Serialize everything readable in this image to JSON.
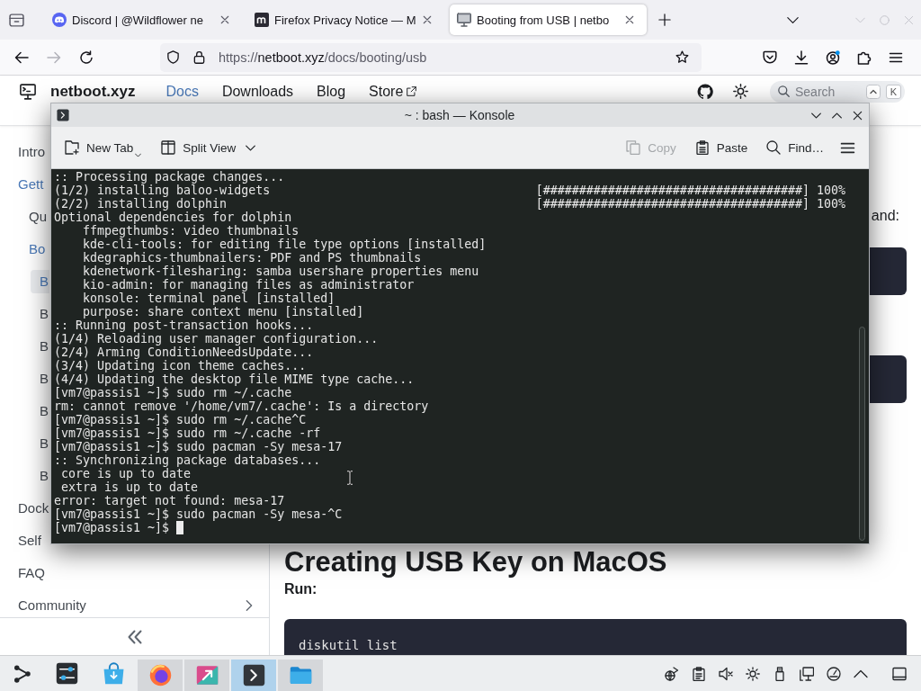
{
  "browser": {
    "tabs": [
      {
        "title": "Discord | @Wildflower ne",
        "selected": false
      },
      {
        "title": "Firefox Privacy Notice — M",
        "selected": false
      },
      {
        "title": "Booting from USB | netbo",
        "selected": true
      }
    ],
    "nav_buttons": [
      {
        "disabled": false
      },
      {
        "disabled": true
      },
      {
        "disabled": false
      }
    ],
    "url": "https://**netboot.xyz**/docs/booting/usb"
  },
  "site": {
    "header": {
      "title": "netboot.xyz",
      "links": [
        {
          "label": "Docs",
          "selected": true,
          "external": false
        },
        {
          "label": "Downloads",
          "selected": false,
          "external": false
        },
        {
          "label": "Blog",
          "selected": false,
          "external": false
        },
        {
          "label": "Store",
          "selected": false,
          "external": true
        }
      ],
      "search": {
        "placeholder": "Search",
        "key": "K"
      }
    },
    "sidebar": {
      "items": [
        {
          "label": "Intro",
          "selected": false
        },
        {
          "label": "Gett",
          "selected": false,
          "expanded": true,
          "children": [
            {
              "label": "Qu",
              "selected": false
            },
            {
              "label": "Bo",
              "selected": false,
              "expanded": true,
              "children": [
                {
                  "label": "B",
                  "selected": true
                },
                {
                  "label": "B",
                  "selected": false
                },
                {
                  "label": "B",
                  "selected": false
                },
                {
                  "label": "B",
                  "selected": false
                },
                {
                  "label": "B",
                  "selected": false
                },
                {
                  "label": "B",
                  "selected": false
                },
                {
                  "label": "B",
                  "selected": false
                }
              ]
            }
          ]
        },
        {
          "label": "Dock",
          "selected": false
        },
        {
          "label": "Self",
          "selected": false
        },
        {
          "label": "FAQ",
          "selected": false
        },
        {
          "label": "Community",
          "selected": false,
          "expanded": false
        }
      ]
    },
    "content": {
      "paragraph_end": "and:",
      "heading": "Creating USB Key on MacOS",
      "step_label": "Run:",
      "code": "diskutil list"
    }
  },
  "konsole": {
    "title": "~ : bash — Konsole",
    "toolbar": [
      {
        "label": "New Tab",
        "disabled": false
      },
      {
        "label": "Split View",
        "disabled": false
      },
      {
        "label": "Copy",
        "disabled": true
      },
      {
        "label": "Paste",
        "disabled": false
      },
      {
        "label": "Find…",
        "disabled": false
      }
    ],
    "terminal": {
      "lines": [
        {
          "kind": "out",
          "text": ":: Processing package changes..."
        },
        {
          "kind": "out",
          "text": "(1/2) installing baloo-widgets",
          "progress": "[####################################] 100%"
        },
        {
          "kind": "out",
          "text": "(2/2) installing dolphin",
          "progress": "[####################################] 100%"
        },
        {
          "kind": "out",
          "text": "Optional dependencies for dolphin"
        },
        {
          "kind": "dep",
          "text": "ffmpegthumbs: video thumbnails"
        },
        {
          "kind": "dep",
          "text": "kde-cli-tools: for editing file type options [installed]"
        },
        {
          "kind": "dep",
          "text": "kdegraphics-thumbnailers: PDF and PS thumbnails"
        },
        {
          "kind": "dep",
          "text": "kdenetwork-filesharing: samba usershare properties menu"
        },
        {
          "kind": "dep",
          "text": "kio-admin: for managing files as administrator"
        },
        {
          "kind": "dep",
          "text": "konsole: terminal panel [installed]"
        },
        {
          "kind": "dep",
          "text": "purpose: share context menu [installed]"
        },
        {
          "kind": "out",
          "text": ":: Running post-transaction hooks..."
        },
        {
          "kind": "out",
          "text": "(1/4) Reloading user manager configuration..."
        },
        {
          "kind": "out",
          "text": "(2/4) Arming ConditionNeedsUpdate..."
        },
        {
          "kind": "out",
          "text": "(3/4) Updating icon theme caches..."
        },
        {
          "kind": "out",
          "text": "(4/4) Updating the desktop file MIME type cache..."
        },
        {
          "kind": "out",
          "text": "[vm7@passis1 ~]$ sudo rm ~/.cache"
        },
        {
          "kind": "out",
          "text": "rm: cannot remove '/home/vm7/.cache': Is a directory"
        },
        {
          "kind": "out",
          "text": "[vm7@passis1 ~]$ sudo rm ~/.cache^C"
        },
        {
          "kind": "out",
          "text": "[vm7@passis1 ~]$ sudo rm ~/.cache -rf"
        },
        {
          "kind": "out",
          "text": "[vm7@passis1 ~]$ sudo pacman -Sy mesa-17"
        },
        {
          "kind": "out",
          "text": ":: Synchronizing package databases..."
        },
        {
          "kind": "repo",
          "text": "core is up to date"
        },
        {
          "kind": "repo",
          "text": "extra is up to date"
        },
        {
          "kind": "out",
          "text": "error: target not found: mesa-17"
        },
        {
          "kind": "out",
          "text": "[vm7@passis1 ~]$ sudo pacman -Sy mesa-^C"
        }
      ],
      "prompt": {
        "text": "[vm7@passis1 ~]$",
        "cursor": true
      }
    }
  },
  "taskbar": {
    "apps": [
      {
        "running": false,
        "selected": false
      },
      {
        "running": false,
        "selected": false
      },
      {
        "running": true,
        "selected": false
      },
      {
        "running": true,
        "selected": false
      },
      {
        "running": true,
        "selected": true
      },
      {
        "running": true,
        "selected": false
      }
    ]
  }
}
